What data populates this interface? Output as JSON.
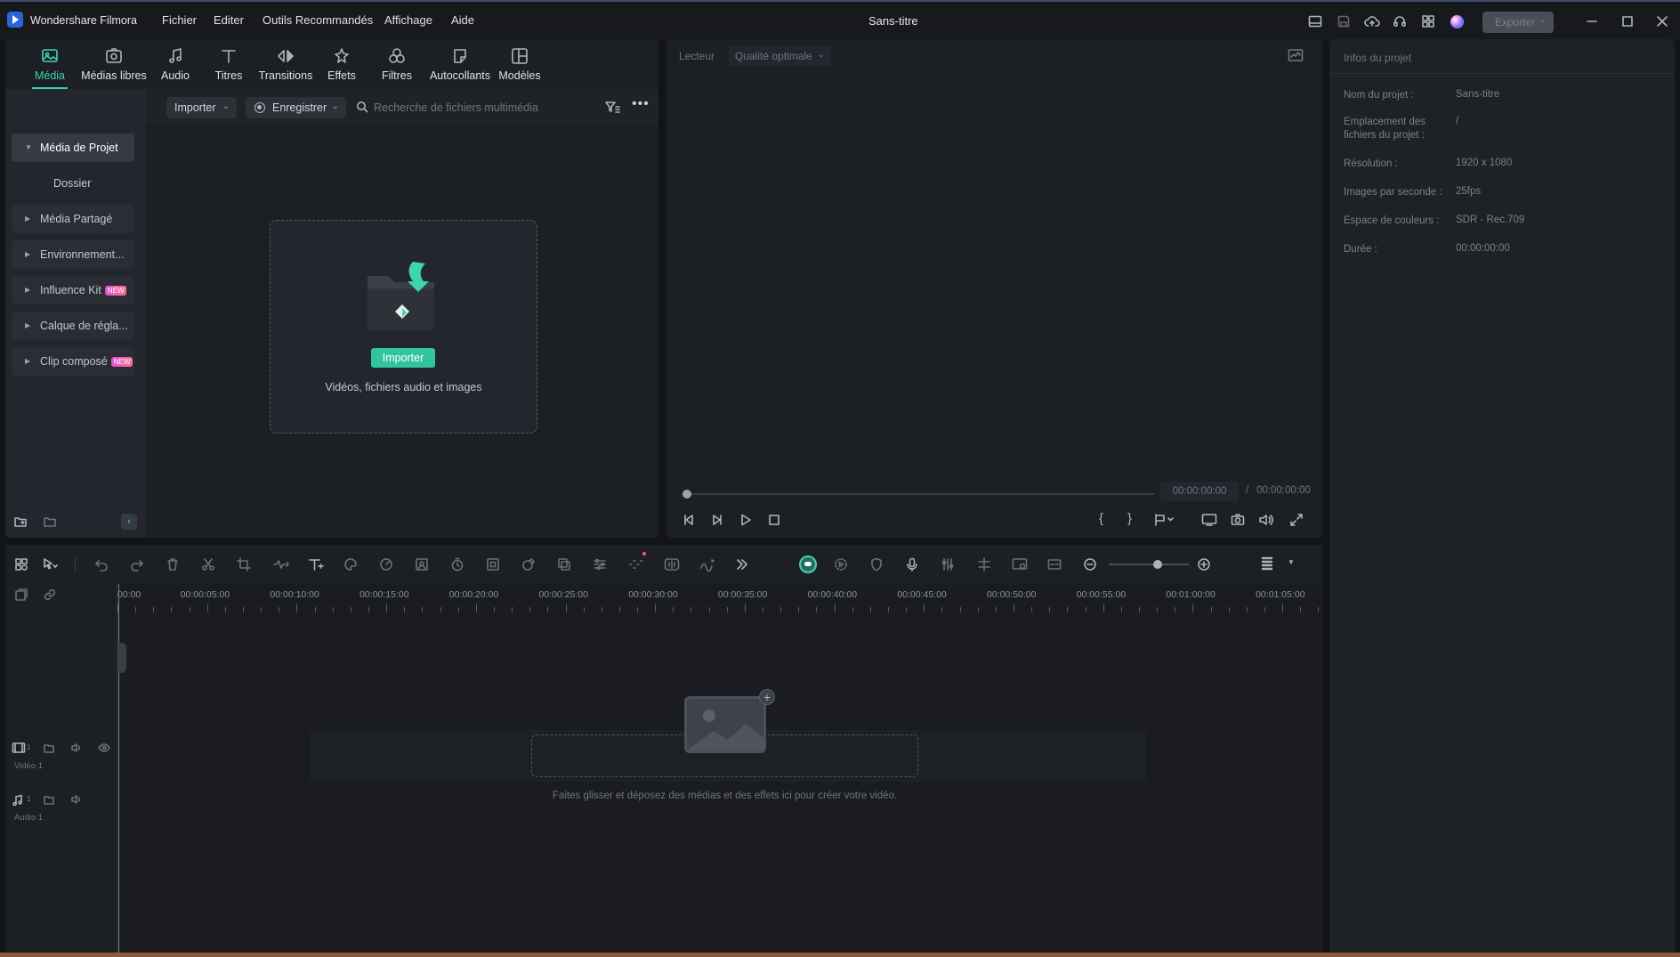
{
  "app": {
    "name": "Wondershare Filmora",
    "title": "Sans-titre",
    "export_label": "Exporter"
  },
  "menu": [
    "Fichier",
    "Editer",
    "Outils Recommandés",
    "Affichage",
    "Aide"
  ],
  "tabs": [
    {
      "label": "Média",
      "icon": "media-icon",
      "active": true
    },
    {
      "label": "Médias libres",
      "icon": "stock-media-icon"
    },
    {
      "label": "Audio",
      "icon": "music-note-icon"
    },
    {
      "label": "Titres",
      "icon": "text-t-icon"
    },
    {
      "label": "Transitions",
      "icon": "transition-icon"
    },
    {
      "label": "Effets",
      "icon": "effects-icon"
    },
    {
      "label": "Filtres",
      "icon": "filters-icon"
    },
    {
      "label": "Autocollants",
      "icon": "sticker-icon"
    },
    {
      "label": "Modèles",
      "icon": "templates-icon"
    }
  ],
  "sidebar": {
    "items": [
      {
        "label": "Média de Projet",
        "selected": true
      },
      {
        "label": "Dossier",
        "child": true
      },
      {
        "label": "Média Partagé"
      },
      {
        "label": "Environnement..."
      },
      {
        "label": "Influence Kit",
        "badge": "NEW"
      },
      {
        "label": "Calque de régla..."
      },
      {
        "label": "Clip composé",
        "badge": "NEW"
      }
    ]
  },
  "media_toolbar": {
    "import_label": "Importer",
    "record_label": "Enregistrer",
    "search_placeholder": "Recherche de fichiers multimédia"
  },
  "dropzone": {
    "button_label": "Importer",
    "hint": "Vidéos, fichiers audio et images"
  },
  "player": {
    "label": "Lecteur",
    "quality": "Qualité optimale",
    "current_time": "00:00:00:00",
    "separator": "/",
    "total_time": "00:00:00:00"
  },
  "project_info": {
    "title": "Infos du projet",
    "rows": [
      {
        "label": "Nom du projet :",
        "value": "Sans-titre"
      },
      {
        "label": "Emplacement des fichiers du projet :",
        "value": "/"
      },
      {
        "label": "Résolution :",
        "value": "1920 x 1080"
      },
      {
        "label": "Images par seconde :",
        "value": "25fps"
      },
      {
        "label": "Espace de couleurs :",
        "value": "SDR - Rec.709"
      },
      {
        "label": "Durée :",
        "value": "00:00:00:00"
      }
    ]
  },
  "timeline": {
    "ruler_labels": [
      "00:00",
      "00:00:05:00",
      "00:00:10:00",
      "00:00:15:00",
      "00:00:20:00",
      "00:00:25:00",
      "00:00:30:00",
      "00:00:35:00",
      "00:00:40:00",
      "00:00:45:00",
      "00:00:50:00",
      "00:00:55:00",
      "00:01:00:00",
      "00:01:05:00"
    ],
    "tracks": [
      {
        "label": "Vidéo 1",
        "index": "1"
      },
      {
        "label": "Audio 1",
        "index": "1"
      }
    ],
    "empty_hint": "Faites glisser et déposez des médias et des effets ici pour créer votre vidéo."
  },
  "colors": {
    "accent": "#3fd3b2",
    "import_button": "#32c4a1",
    "background": "#121418",
    "panel": "#1c1f24"
  }
}
